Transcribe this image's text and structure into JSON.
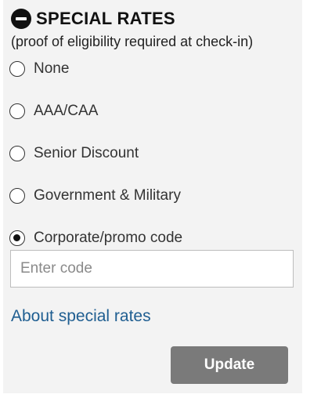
{
  "section": {
    "title": "SPECIAL RATES",
    "subtitle": "(proof of eligibility required at check-in)",
    "collapse_icon": "minus-circle-icon"
  },
  "options": [
    {
      "label": "None",
      "checked": false
    },
    {
      "label": "AAA/CAA",
      "checked": false
    },
    {
      "label": "Senior Discount",
      "checked": false
    },
    {
      "label": "Government & Military",
      "checked": false
    },
    {
      "label": "Corporate/promo code",
      "checked": true
    }
  ],
  "code_input": {
    "placeholder": "Enter code",
    "value": ""
  },
  "about_link": "About special rates",
  "update_button": "Update",
  "colors": {
    "panel_bg": "#f3f3f3",
    "link": "#1f5e91",
    "button_bg": "#7a7a7a",
    "button_text": "#ffffff"
  }
}
